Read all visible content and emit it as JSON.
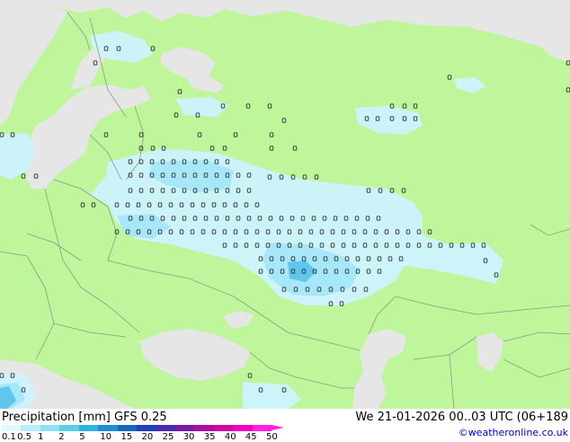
{
  "footer": {
    "title_left": "Precipitation [mm]  GFS 0.25",
    "title_right": "We 21-01-2026 00..03 UTC (06+189",
    "credit": "©weatheronline.co.uk"
  },
  "legend": {
    "ticks": [
      "0.1",
      "0.5",
      "1",
      "2",
      "5",
      "10",
      "15",
      "20",
      "25",
      "30",
      "35",
      "40",
      "45",
      "50"
    ],
    "colors": [
      "#e0f8ff",
      "#b8ecfb",
      "#8ee0f5",
      "#5ecde8",
      "#2fb4e0",
      "#1e8ed0",
      "#1468bf",
      "#2040b8",
      "#4a2ab0",
      "#7a1aa8",
      "#a810a0",
      "#d008a0",
      "#f000c0",
      "#ff20e0"
    ]
  },
  "map": {
    "colors": {
      "land": "#bff59b",
      "sea": "#e6e6e6",
      "border": "#8a9a8a",
      "rain_light": "#cdf3fd",
      "rain_mid": "#a6e7f8",
      "rain_heavy": "#5fc7ec"
    }
  }
}
